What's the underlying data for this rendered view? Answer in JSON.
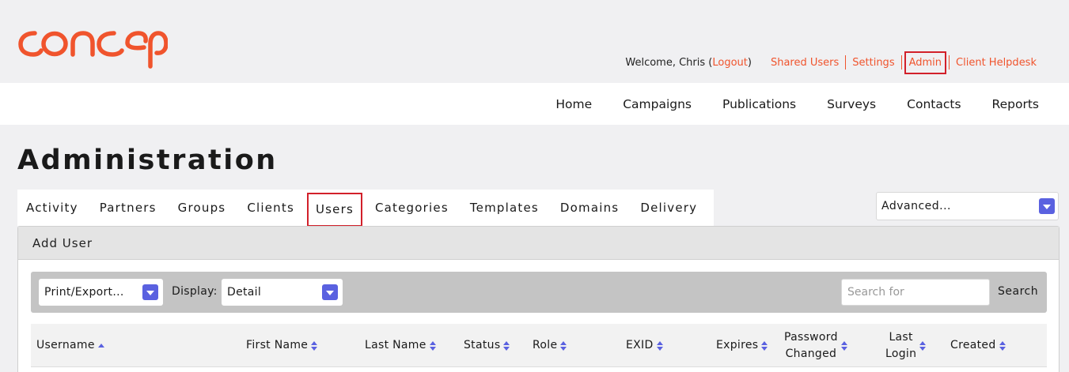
{
  "header": {
    "welcome_prefix": "Welcome, Chris (",
    "logout": "Logout",
    "welcome_suffix": ")",
    "links": [
      "Shared Users",
      "Settings",
      "Admin",
      "Client Helpdesk"
    ],
    "accent_color": "#f0542d"
  },
  "nav": [
    "Home",
    "Campaigns",
    "Publications",
    "Surveys",
    "Contacts",
    "Reports"
  ],
  "page_title": "Administration",
  "tabs": [
    "Activity",
    "Partners",
    "Groups",
    "Clients",
    "Users",
    "Categories",
    "Templates",
    "Domains",
    "Delivery"
  ],
  "active_tab": "Users",
  "advanced_select": "Advanced...",
  "panel": {
    "title": "Add User",
    "print_export": "Print/Export...",
    "display_label": "Display:",
    "display_value": "Detail",
    "search_placeholder": "Search for",
    "search_button": "Search"
  },
  "table": {
    "columns": [
      {
        "label": "Username",
        "sort": "asc"
      },
      {
        "label": "First Name",
        "sort": "both"
      },
      {
        "label": "Last Name",
        "sort": "both"
      },
      {
        "label": "Status",
        "sort": "both"
      },
      {
        "label": "Role",
        "sort": "both"
      },
      {
        "label": "EXID",
        "sort": "both"
      },
      {
        "label": "Expires",
        "sort": "both"
      },
      {
        "label_line1": "Password",
        "label_line2": "Changed",
        "sort": "both"
      },
      {
        "label_line1": "Last",
        "label_line2": "Login",
        "sort": "both"
      },
      {
        "label": "Created",
        "sort": "both"
      }
    ]
  },
  "icons": {
    "dropdown": "chevron-down-icon",
    "sort": "sort-arrows-icon"
  }
}
